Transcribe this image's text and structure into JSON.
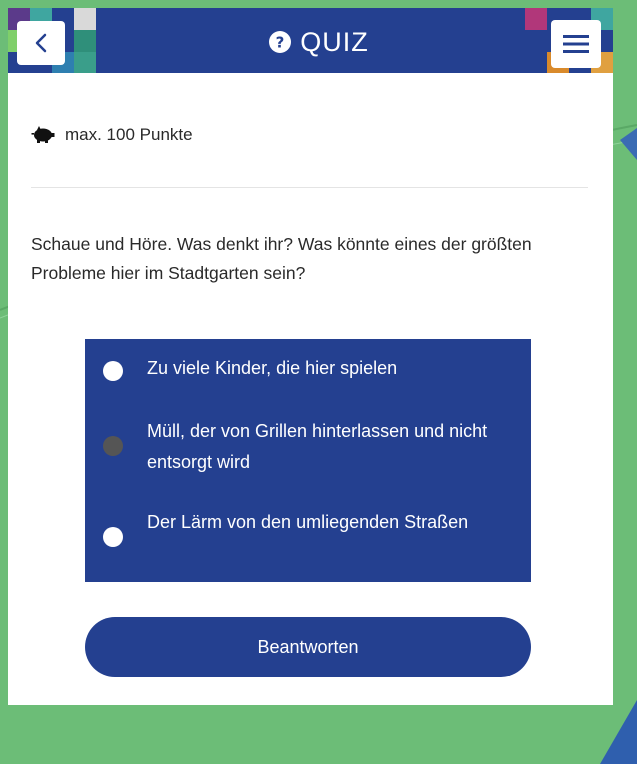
{
  "header": {
    "title": "QUIZ",
    "back_icon": "chevron-left-icon",
    "title_icon": "question-circle-icon",
    "menu_icon": "hamburger-menu-icon",
    "bar_color": "#244090"
  },
  "points": {
    "icon": "piggy-bank-icon",
    "text": "max. 100 Punkte"
  },
  "question": {
    "text": "Schaue und Höre. Was denkt ihr? Was könnte eines der größten Probleme hier im Stadtgarten sein?"
  },
  "options": [
    {
      "label": "Zu viele Kinder, die hier spielen",
      "selected": false
    },
    {
      "label": "Müll, der von Grillen hinterlassen und nicht entsorgt wird",
      "selected": true
    },
    {
      "label": "Der Lärm von den umliegenden Straßen",
      "selected": false
    }
  ],
  "submit": {
    "label": "Beantworten"
  },
  "colors": {
    "background": "#6cbd77",
    "primary": "#244090",
    "selected_radio": "#555555"
  }
}
